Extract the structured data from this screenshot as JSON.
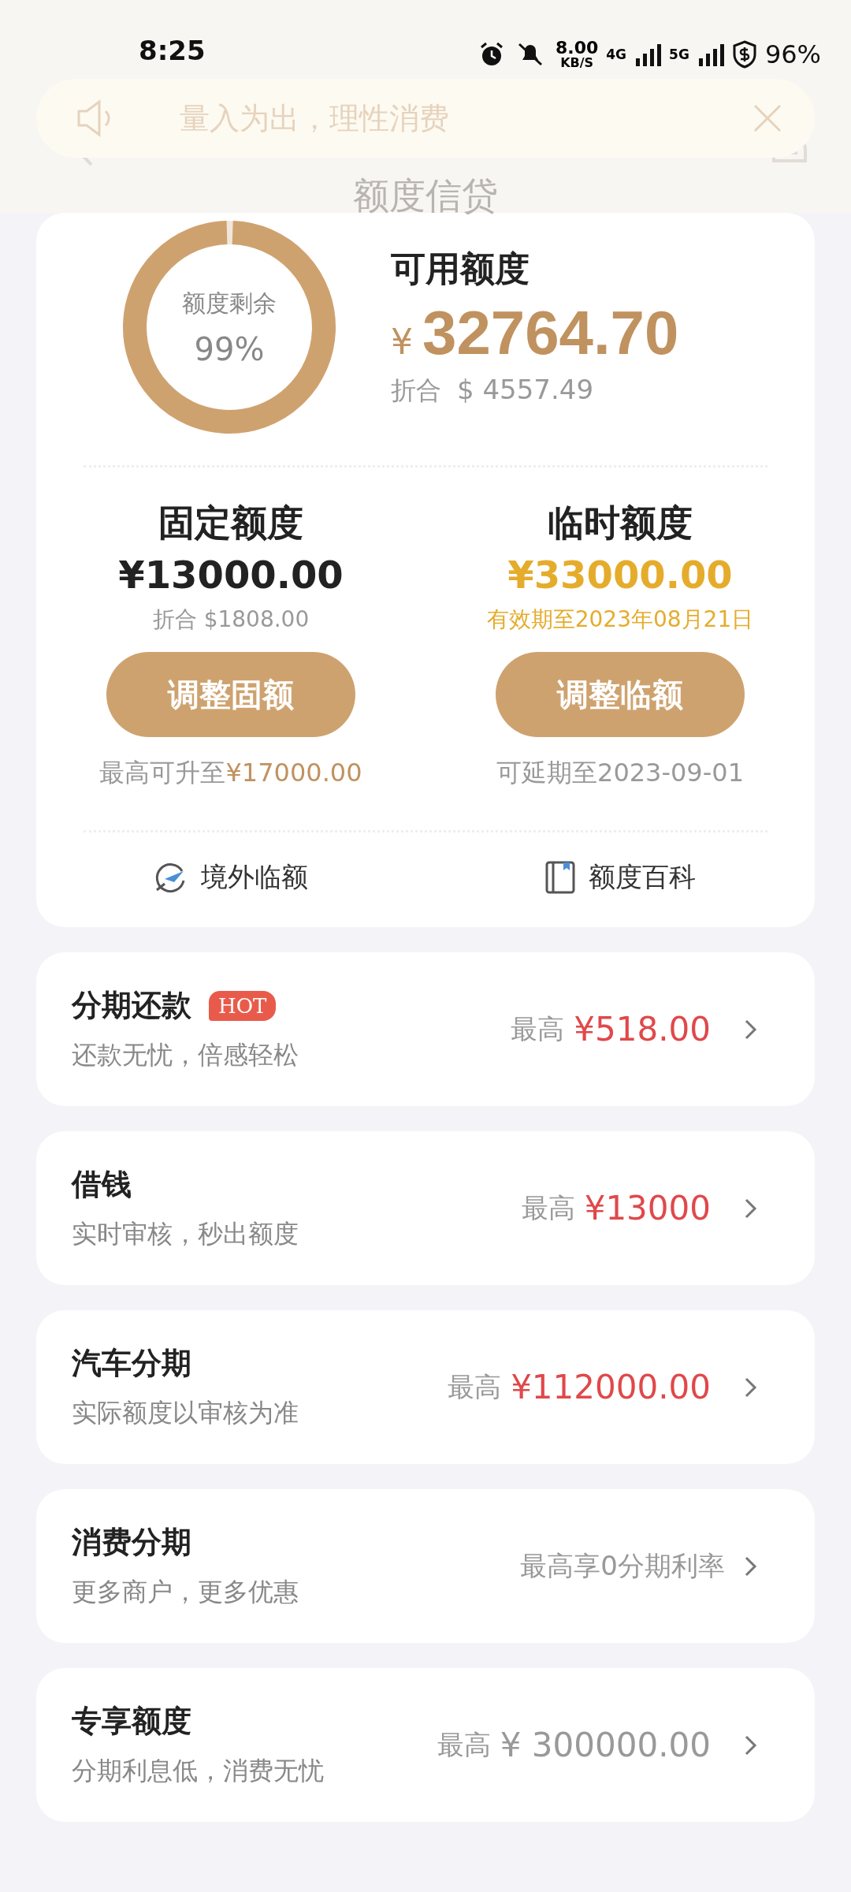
{
  "status_bar": {
    "time": "8:25",
    "speed_value": "8.00",
    "speed_unit": "KB/S",
    "network_1": "4G",
    "network_2": "5G",
    "battery": "96%"
  },
  "notice": {
    "text": "量入为出，理性消费"
  },
  "header": {
    "title": "额度信贷"
  },
  "summary": {
    "ring_label": "额度剩余",
    "ring_percent": "99%",
    "title": "可用额度",
    "currency": "¥",
    "amount": "32764.70",
    "converted_label": "折合",
    "converted_amount": "$ 4557.49"
  },
  "quotas": [
    {
      "title": "固定额度",
      "amount": "¥13000.00",
      "highlight": false,
      "note": "折合 $1808.00",
      "button": "调整固额",
      "footer_label": "最高可升至",
      "footer_amount": "¥17000.00"
    },
    {
      "title": "临时额度",
      "amount": "¥33000.00",
      "highlight": true,
      "note": "有效期至2023年08月21日",
      "button": "调整临额",
      "footer_label": "可延期至2023-09-01"
    }
  ],
  "links": [
    {
      "kind": "plane",
      "label": "境外临额"
    },
    {
      "kind": "book",
      "label": "额度百科"
    }
  ],
  "products": [
    {
      "title": "分期还款",
      "badge": "HOT",
      "subtitle": "还款无忧，倍感轻松",
      "value_label": "最高",
      "value_amount": "¥518.00",
      "highlight": true
    },
    {
      "title": "借钱",
      "subtitle": "实时审核，秒出额度",
      "value_label": "最高",
      "value_amount": "¥13000",
      "highlight": true
    },
    {
      "title": "汽车分期",
      "subtitle": "实际额度以审核为准",
      "value_label": "最高",
      "value_amount": "¥112000.00",
      "highlight": true
    },
    {
      "title": "消费分期",
      "subtitle": "更多商户，更多优惠",
      "value_label": "最高享0分期利率"
    },
    {
      "title": "专享额度",
      "subtitle": "分期利息低，消费无忧",
      "value_label": "最高",
      "value_amount": "¥ 300000.00",
      "highlight": false
    }
  ]
}
